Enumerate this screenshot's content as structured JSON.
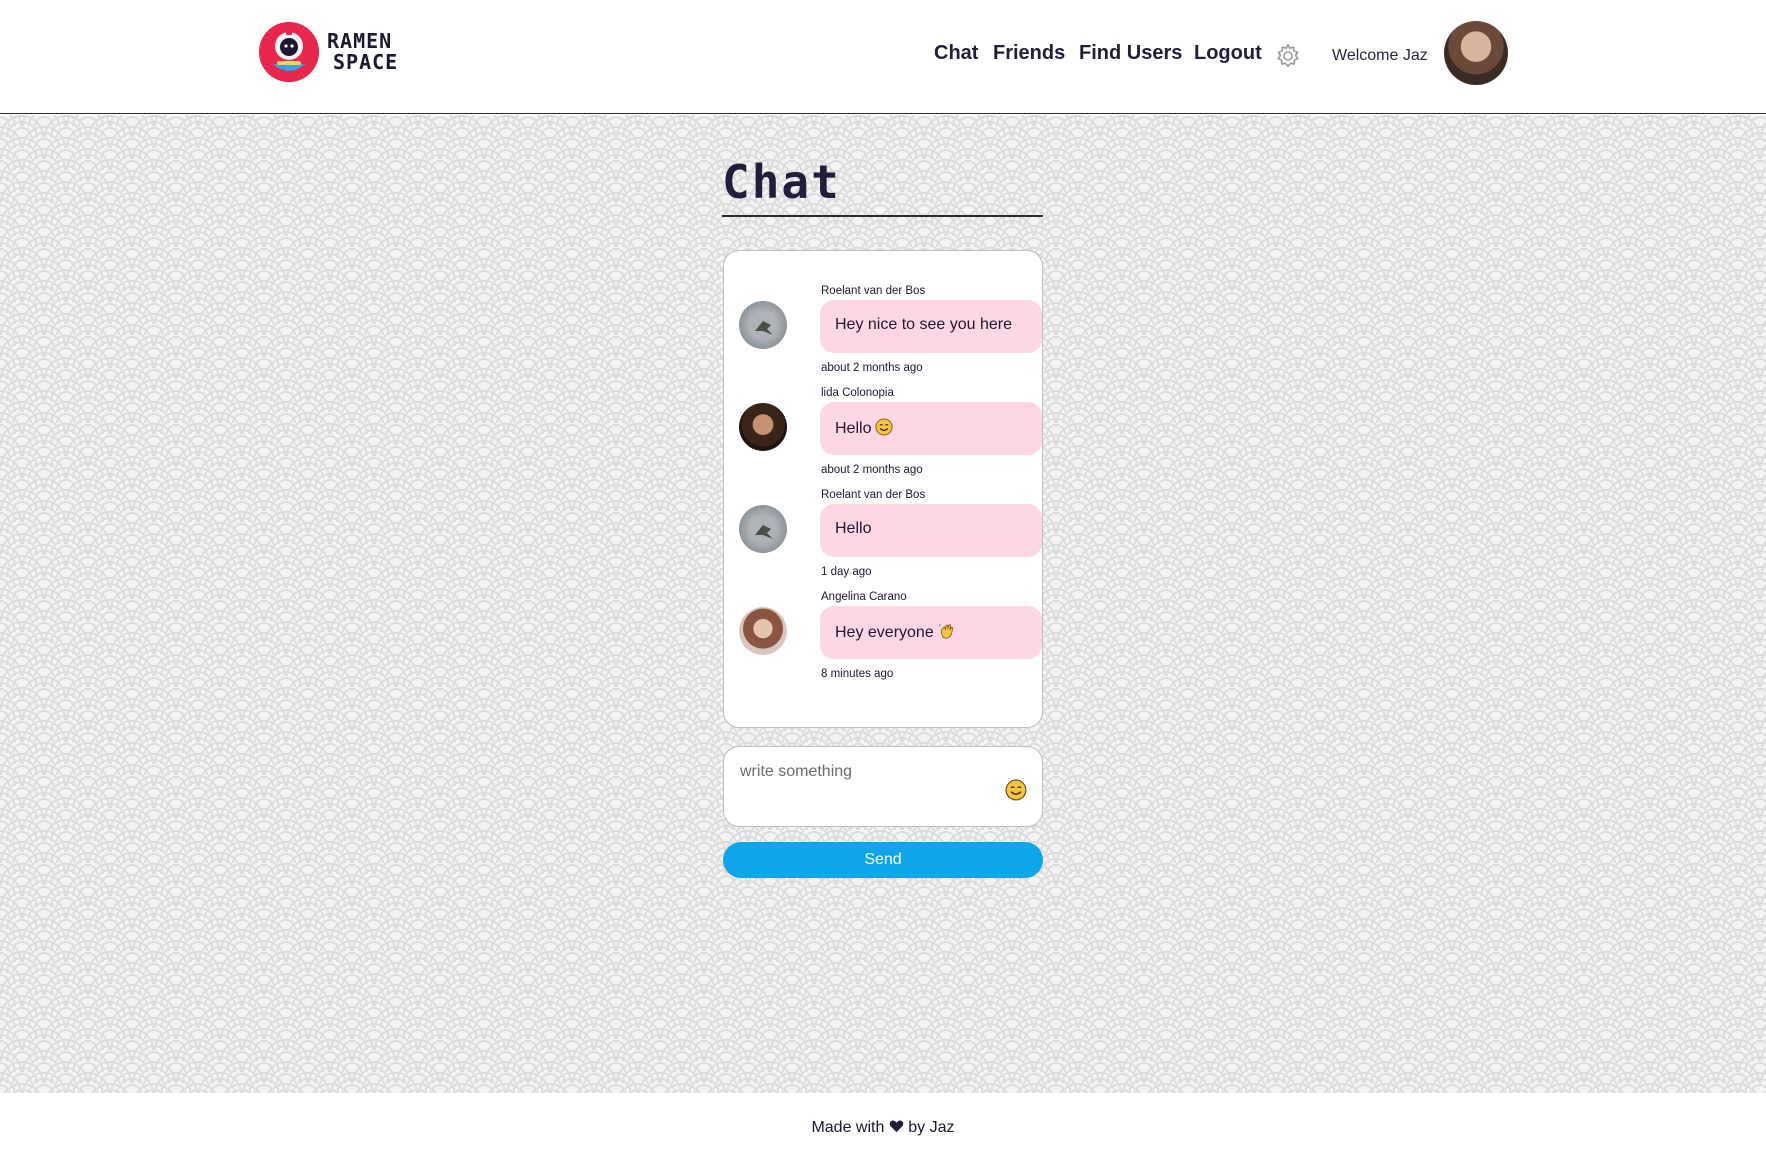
{
  "header": {
    "logo_line1": "RAMEN",
    "logo_line2": "SPACE",
    "nav": {
      "chat": "Chat",
      "friends": "Friends",
      "find_users": "Find Users",
      "logout": "Logout"
    },
    "settings_icon": "gear-icon",
    "welcome": "Welcome Jaz"
  },
  "main": {
    "title": "Chat",
    "messages": [
      {
        "author": "Roelant van der Bos",
        "text": "Hey nice to see you here",
        "time": "about 2 months ago",
        "emoji": ""
      },
      {
        "author": "lida Colonopia",
        "text": "Hello",
        "time": "about 2 months ago",
        "emoji": "smiling-face-emoji"
      },
      {
        "author": "Roelant van der Bos",
        "text": "Hello",
        "time": "1 day ago",
        "emoji": ""
      },
      {
        "author": "Angelina Carano",
        "text": "Hey everyone",
        "time": "8 minutes ago",
        "emoji": "waving-hand-emoji"
      }
    ],
    "composer": {
      "placeholder": "write something",
      "value": "",
      "emoji_icon": "smiling-face-icon"
    },
    "send_label": "Send"
  },
  "footer": {
    "prefix": "Made with",
    "suffix": "by Jaz",
    "icon": "heart-icon"
  },
  "colors": {
    "accent": "#0ea5e9",
    "bubble": "#ffd6e4",
    "brand": "#e8274f",
    "text": "#1d1830"
  }
}
